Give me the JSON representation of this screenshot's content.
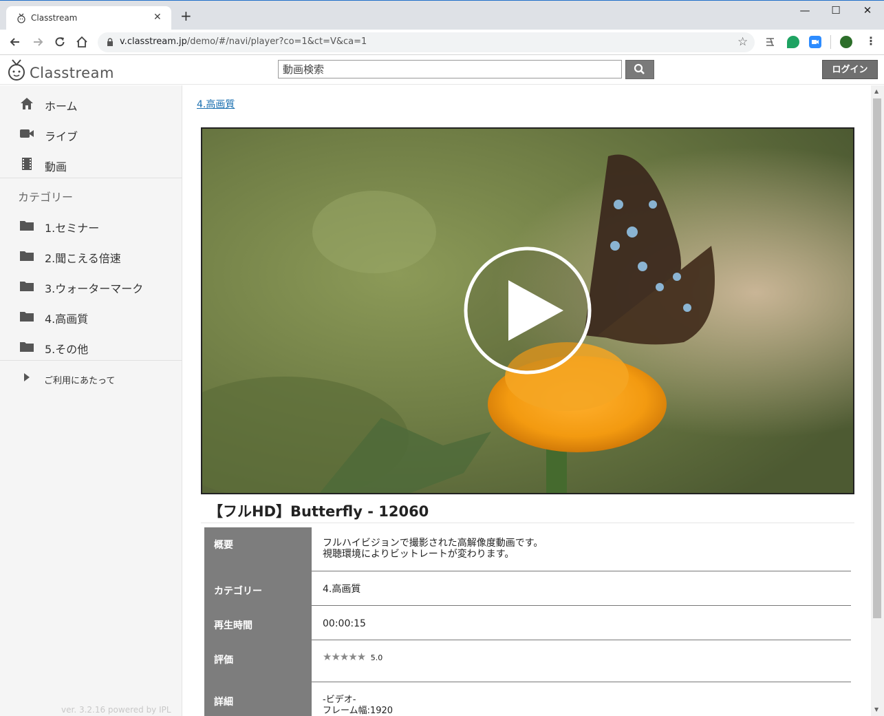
{
  "browser": {
    "tab_title": "Classtream",
    "new_tab": "+",
    "close_tab": "✕",
    "url_host": "v.classtream.jp",
    "url_path": "/demo/#/navi/player?co=1&ct=V&ca=1",
    "window_controls": {
      "minimize": "—",
      "maximize": "☐",
      "close": "✕"
    }
  },
  "header": {
    "logo_text": "Classtream",
    "search_placeholder": "動画検索",
    "login_label": "ログイン"
  },
  "sidebar": {
    "nav": [
      {
        "label": "ホーム",
        "icon": "home-icon"
      },
      {
        "label": "ライブ",
        "icon": "video-camera-icon"
      },
      {
        "label": "動画",
        "icon": "film-icon"
      }
    ],
    "category_heading": "カテゴリー",
    "categories": [
      {
        "label": "1.セミナー",
        "icon": "folder-icon"
      },
      {
        "label": "2.聞こえる倍速",
        "icon": "folder-icon"
      },
      {
        "label": "3.ウォーターマーク",
        "icon": "folder-icon"
      },
      {
        "label": "4.高画質",
        "icon": "folder-icon"
      },
      {
        "label": "5.その他",
        "icon": "folder-icon"
      }
    ],
    "about_label": "ご利用にあたって",
    "version": "ver. 3.2.16 powered by IPL"
  },
  "main": {
    "breadcrumb": "4.高画質",
    "video_title": "【フルHD】Butterfly - 12060",
    "details": [
      {
        "head": "概要",
        "value": "フルハイビジョンで撮影された高解像度動画です。",
        "value2": "視聴環境によりビットレートが変わります。"
      },
      {
        "head": "カテゴリー",
        "value": "4.高画質"
      },
      {
        "head": "再生時間",
        "value": "00:00:15"
      },
      {
        "head": "評価",
        "stars": "★★★★★",
        "rating": 5.0,
        "rating_text": "5.0"
      },
      {
        "head": "詳細",
        "value": "-ビデオ-",
        "value2": "フレーム幅:1920"
      }
    ]
  },
  "colors": {
    "sidebar_bg": "#f5f5f5",
    "table_head_bg": "#7d7d7d",
    "link": "#1a6fb0",
    "button_gray": "#6f6f6f"
  }
}
